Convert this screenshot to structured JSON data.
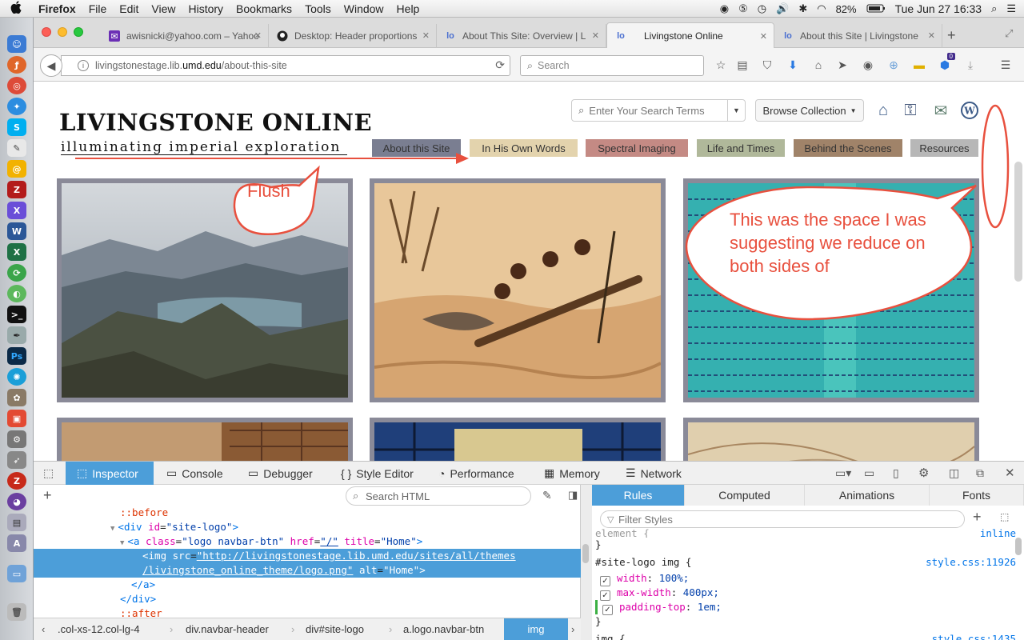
{
  "menubar": {
    "apple": "",
    "items": [
      "Firefox",
      "File",
      "Edit",
      "View",
      "History",
      "Bookmarks",
      "Tools",
      "Window",
      "Help"
    ],
    "battery": "82%",
    "clock": "Tue Jun 27  16:33"
  },
  "tabs": [
    {
      "title": "awisnicki@yahoo.com – Yahoo",
      "icon": "mail-icon"
    },
    {
      "title": "Desktop: Header proportions",
      "icon": "github-icon"
    },
    {
      "title": "About This Site: Overview | L",
      "icon": "livingstone-icon"
    },
    {
      "title": "Livingstone Online",
      "icon": "livingstone-icon",
      "active": true
    },
    {
      "title": "About this Site | Livingstone",
      "icon": "livingstone-icon"
    }
  ],
  "new_tab": "+",
  "navbar": {
    "url_prefix": "livingstonestage.lib.",
    "url_host": "umd.edu",
    "url_path": "/about-this-site",
    "search_placeholder": "Search",
    "notification_badge": "0"
  },
  "site": {
    "logo_title": "LIVINGSTONE ONLINE",
    "logo_subtitle": "illuminating imperial exploration",
    "search_placeholder": "Enter Your Search Terms",
    "browse_label": "Browse Collection",
    "nav": [
      {
        "label": "About this Site",
        "color": "#7a7e91"
      },
      {
        "label": "In His Own Words",
        "color": "#e3d3ad"
      },
      {
        "label": "Spectral Imaging",
        "color": "#c48a84"
      },
      {
        "label": "Life and Times",
        "color": "#b0b89a"
      },
      {
        "label": "Behind the Scenes",
        "color": "#a08369"
      },
      {
        "label": "Resources",
        "color": "#b7b7b7"
      }
    ]
  },
  "annotations": {
    "flush_label": "Flush",
    "space_note": "This was the space I was suggesting we reduce on both sides of",
    "color": "#e8503e"
  },
  "devtools": {
    "tabs": [
      "Inspector",
      "Console",
      "Debugger",
      "Style Editor",
      "Performance",
      "Memory",
      "Network"
    ],
    "html_search_placeholder": "Search HTML",
    "html_lines": {
      "before": "::before",
      "div_open_tag": "<div",
      "div_attr": "id",
      "div_val": "\"site-logo\"",
      "div_close": ">",
      "a_tag": "<a",
      "a_class_attr": "class",
      "a_class_val": "\"logo navbar-btn\"",
      "a_href_attr": "href",
      "a_href_val": "\"/\"",
      "a_title_attr": "title",
      "a_title_val": "\"Home\"",
      "img_tag": "<img",
      "img_src_attr": "src",
      "img_src_val_1": "\"http://livingstonestage.lib.umd.edu/sites/all/themes",
      "img_src_val_2": "/livingstone_online_theme/logo.png\"",
      "img_alt_attr": "alt",
      "img_alt_val": "\"Home\"",
      "a_end": "</a>",
      "div_end": "</div>",
      "after": "::after"
    },
    "breadcrumbs": [
      ".col-xs-12.col-lg-4",
      "div.navbar-header",
      "div#site-logo",
      "a.logo.navbar-btn",
      "img"
    ],
    "rules_tabs": [
      "Rules",
      "Computed",
      "Animations",
      "Fonts"
    ],
    "filter_placeholder": "Filter Styles",
    "element_rule": {
      "selector": "element",
      "brace": "{",
      "close": "}",
      "source": "inline"
    },
    "site_logo_rule": {
      "selector": "#site-logo img",
      "brace": "{",
      "close": "}",
      "source": "style.css:11926",
      "props": [
        {
          "name": "width",
          "value": "100%;"
        },
        {
          "name": "max-width",
          "value": "400px;"
        },
        {
          "name": "padding-top",
          "value": "1em;"
        }
      ]
    },
    "img_rule": {
      "selector": "img",
      "brace": "{",
      "source": "style.css:1435"
    }
  }
}
